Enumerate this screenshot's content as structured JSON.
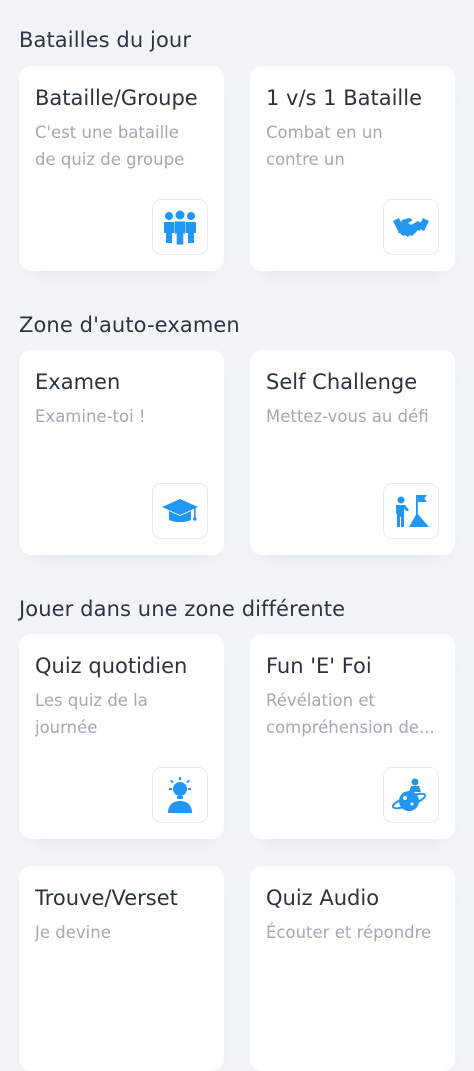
{
  "sections": [
    {
      "title": "Batailles du jour",
      "cards": [
        {
          "title": "Bataille/Groupe",
          "subtitle_lines": [
            "C'est une bataille",
            "de quiz de groupe"
          ],
          "icon": "group-people-icon"
        },
        {
          "title": "1 v/s 1 Bataille",
          "subtitle_lines": [
            "Combat en un",
            "contre un"
          ],
          "icon": "handshake-icon"
        }
      ]
    },
    {
      "title": "Zone d'auto-examen",
      "cards": [
        {
          "title": "Examen",
          "subtitle_lines": [
            "Examine-toi !"
          ],
          "icon": "graduation-cap-icon"
        },
        {
          "title": "Self Challenge",
          "subtitle_lines": [
            "Mettez-vous au défi"
          ],
          "icon": "summit-flag-icon"
        }
      ]
    },
    {
      "title": "Jouer dans une zone différente",
      "cards": [
        {
          "title": "Quiz quotidien",
          "subtitle_lines": [
            "Les quiz de la",
            "journée"
          ],
          "icon": "idea-person-icon"
        },
        {
          "title": "Fun 'E' Foi",
          "subtitle_lines": [
            "Révélation et",
            "compréhension de..."
          ],
          "icon": "planet-astronaut-icon"
        },
        {
          "title": "Trouve/Verset",
          "subtitle_lines": [
            "Je devine"
          ],
          "icon": ""
        },
        {
          "title": "Quiz Audio",
          "subtitle_lines": [
            "Écouter et répondre"
          ],
          "icon": ""
        }
      ]
    }
  ],
  "colors": {
    "accent": "#2196f3",
    "background": "#f2f5f8",
    "card": "#ffffff"
  }
}
